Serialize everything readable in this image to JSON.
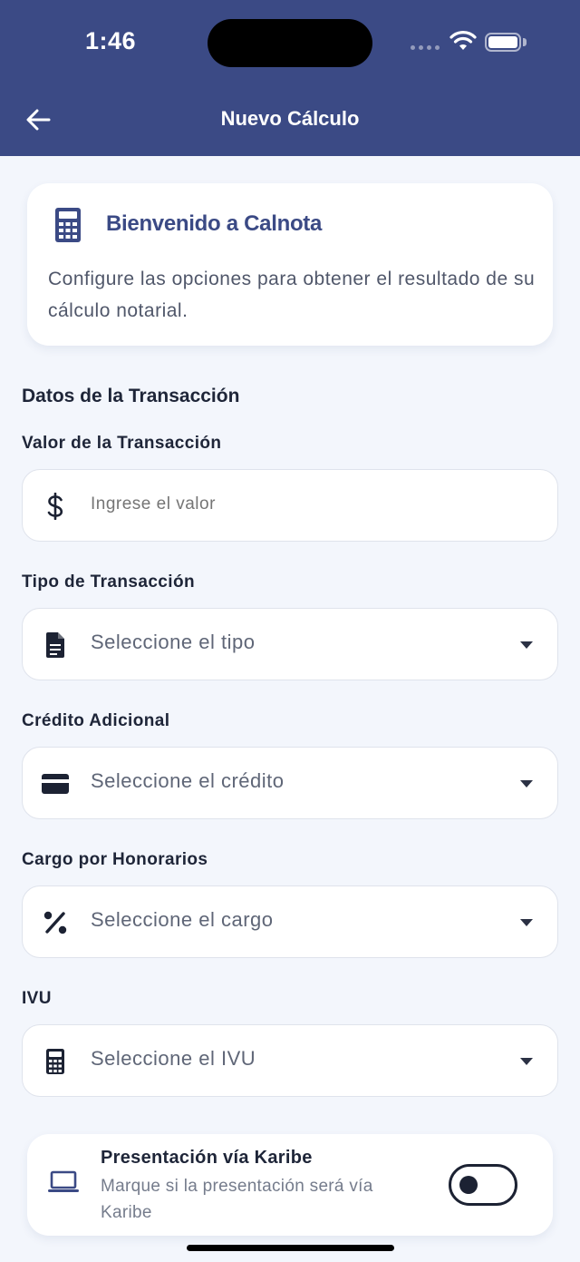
{
  "status_bar": {
    "time": "1:46"
  },
  "nav": {
    "title": "Nuevo Cálculo"
  },
  "welcome": {
    "title": "Bienvenido a Calnota",
    "description": "Configure las opciones para obtener el resultado de su cálculo notarial."
  },
  "section_title": "Datos de la Transacción",
  "fields": {
    "valor": {
      "label": "Valor de la Transacción",
      "placeholder": "Ingrese el valor",
      "value": "",
      "icon": "dollar-icon"
    },
    "tipo": {
      "label": "Tipo de Transacción",
      "selected": "Seleccione el tipo",
      "icon": "document-icon"
    },
    "credito": {
      "label": "Crédito Adicional",
      "selected": "Seleccione el crédito",
      "icon": "credit-card-icon"
    },
    "cargo": {
      "label": "Cargo por Honorarios",
      "selected": "Seleccione el cargo",
      "icon": "percent-icon"
    },
    "ivu": {
      "label": "IVU",
      "selected": "Seleccione el IVU",
      "icon": "calculator-icon"
    }
  },
  "karibe": {
    "title": "Presentación vía Karibe",
    "description": "Marque si la presentación será vía Karibe",
    "enabled": false,
    "icon": "laptop-icon"
  },
  "colors": {
    "primary": "#3b4a85",
    "background": "#f3f6fc",
    "card": "#ffffff"
  }
}
